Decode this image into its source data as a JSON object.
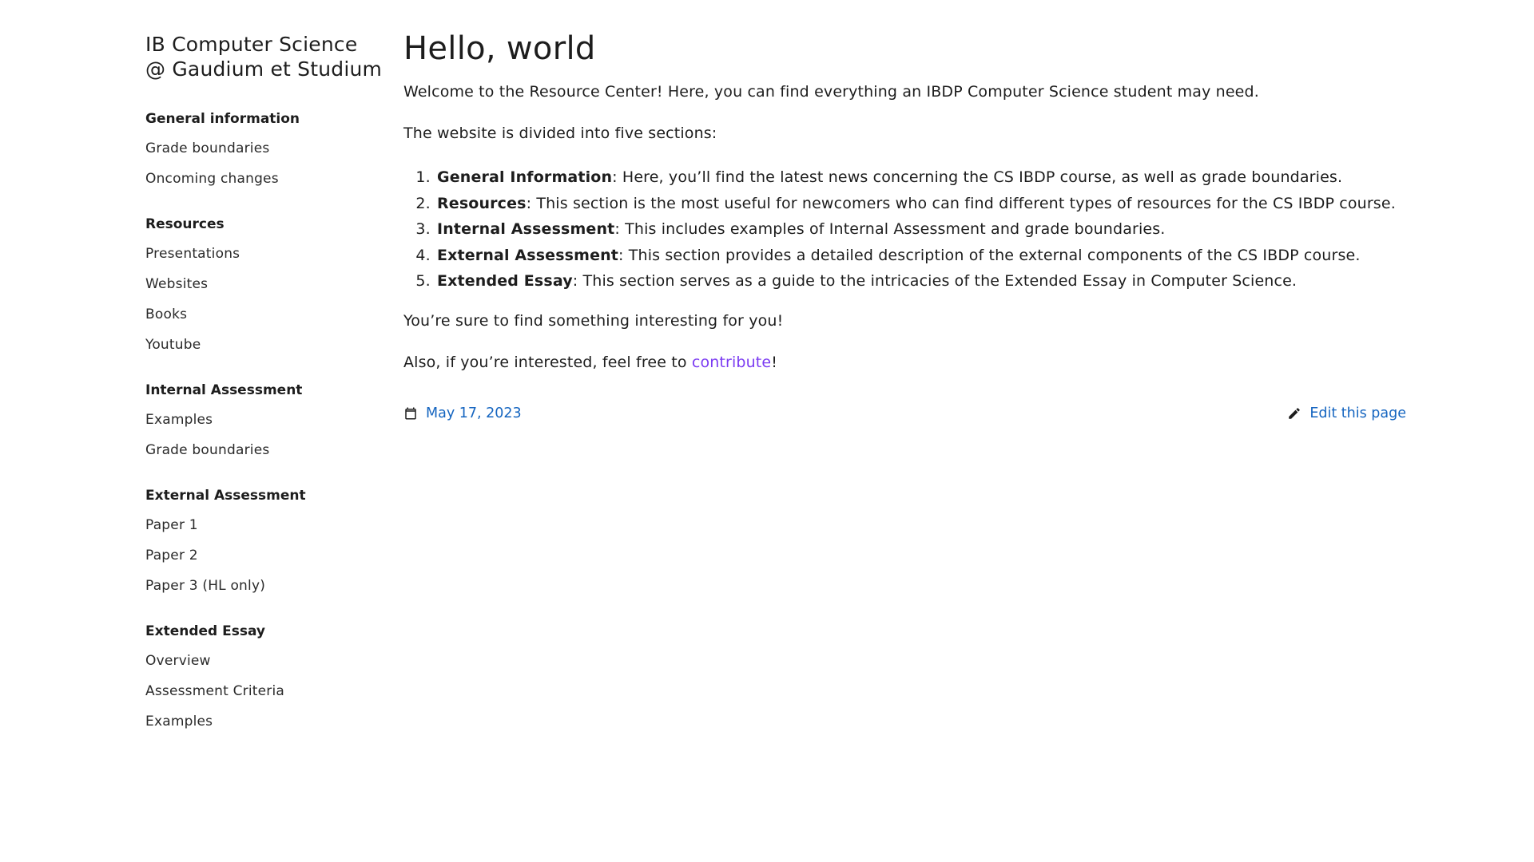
{
  "sidebar": {
    "site_title_line1": "IB Computer Science",
    "site_title_line2": "@ Gaudium et Studium",
    "sections": [
      {
        "title": "General information",
        "items": [
          "Grade boundaries",
          "Oncoming changes"
        ]
      },
      {
        "title": "Resources",
        "items": [
          "Presentations",
          "Websites",
          "Books",
          "Youtube"
        ]
      },
      {
        "title": "Internal Assessment",
        "items": [
          "Examples",
          "Grade boundaries"
        ]
      },
      {
        "title": "External Assessment",
        "items": [
          "Paper 1",
          "Paper 2",
          "Paper 3 (HL only)"
        ]
      },
      {
        "title": "Extended Essay",
        "items": [
          "Overview",
          "Assessment Criteria",
          "Examples"
        ]
      }
    ]
  },
  "main": {
    "title": "Hello, world",
    "intro": "Welcome to the Resource Center! Here, you can find everything an IBDP Computer Science student may need.",
    "sections_intro": "The website is divided into five sections:",
    "list": [
      {
        "label": "General Information",
        "text": ": Here, you’ll find the latest news concerning the CS IBDP course, as well as grade boundaries."
      },
      {
        "label": "Resources",
        "text": ": This section is the most useful for newcomers who can find different types of resources for the CS IBDP course."
      },
      {
        "label": "Internal Assessment",
        "text": ": This includes examples of Internal Assessment and grade boundaries."
      },
      {
        "label": "External Assessment",
        "text": ": This section provides a detailed description of the external components of the CS IBDP course."
      },
      {
        "label": "Extended Essay",
        "text": ": This section serves as a guide to the intricacies of the Extended Essay in Computer Science."
      }
    ],
    "closing": "You’re sure to find something interesting for you!",
    "contribute_prefix": "Also, if you’re interested, feel free to ",
    "contribute_link": "contribute",
    "contribute_suffix": "!",
    "date": "May 17, 2023",
    "edit_label": "Edit this page",
    "icons": {
      "date": "calendar-icon",
      "edit": "pencil-icon"
    },
    "colors": {
      "link": "#1565c0",
      "visited_link": "#7b3bf2"
    }
  }
}
